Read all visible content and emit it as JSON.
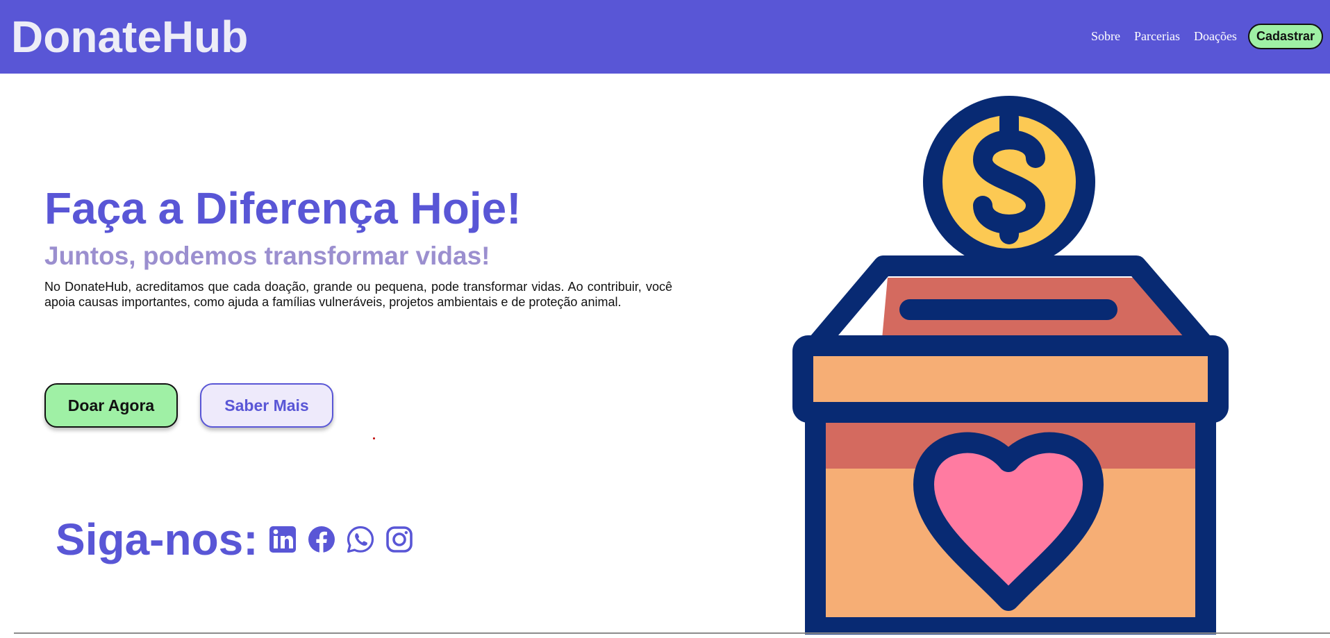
{
  "header": {
    "logo": "DonateHub",
    "nav": [
      "Sobre",
      "Parcerias",
      "Doações"
    ],
    "cta_label": "Cadastrar"
  },
  "hero": {
    "title": "Faça a Diferença Hoje!",
    "subtitle": "Juntos, podemos transformar vidas!",
    "paragraph": "No DonateHub, acreditamos que cada doação, grande ou pequena, pode transformar vidas. Ao contribuir, você apoia causas importantes, como ajuda a famílias vulneráveis, projetos ambientais e de proteção animal.",
    "primary_button": "Doar Agora",
    "secondary_button": "Saber Mais"
  },
  "social": {
    "label": "Siga-nos:",
    "icons": [
      "linkedin-icon",
      "facebook-icon",
      "whatsapp-icon",
      "instagram-icon"
    ]
  },
  "illustration": {
    "icon": "donation-box-icon"
  },
  "colors": {
    "primary": "#5956d6",
    "accent_green": "#9ff0a5",
    "subtitle": "#9b8fcf",
    "box_outline": "#082a73",
    "coin": "#fcc953",
    "box_light": "#f6ae75",
    "box_dark": "#d46a5f",
    "heart": "#ff7ba1"
  }
}
